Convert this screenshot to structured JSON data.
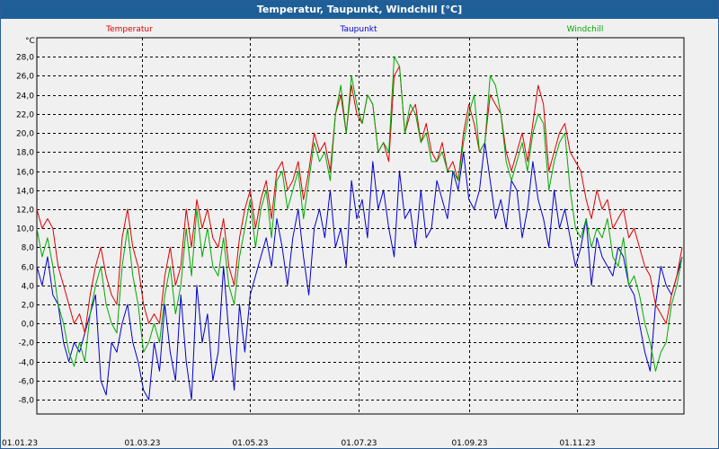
{
  "window": {
    "title": "Temperatur, Taupunkt, Windchill [°C]"
  },
  "chart_data": {
    "type": "line",
    "title": "Temperatur, Taupunkt, Windchill [°C]",
    "ylabel": "°C",
    "xlabel": "",
    "ylim": [
      -9.5,
      30.0
    ],
    "y_ticks": [
      "28,0",
      "26,0",
      "24,0",
      "22,0",
      "20,0",
      "18,0",
      "16,0",
      "14,0",
      "12,0",
      "10,0",
      "8,0",
      "6,0",
      "4,0",
      "2,0",
      "0,0",
      "-2,0",
      "-4,0",
      "-6,0",
      "-8,0"
    ],
    "x_ticks": [
      "01.01.23",
      "01.03.23",
      "01.05.23",
      "01.07.23",
      "01.09.23",
      "01.11.23"
    ],
    "x_tick_days": [
      0,
      59,
      120,
      181,
      243,
      304
    ],
    "x_range_days": [
      0,
      364
    ],
    "grid": true,
    "colors": {
      "Temperatur": "#dd0000",
      "Taupunkt": "#0000cc",
      "Windchill": "#00aa00",
      "background": "#f0f0f0",
      "titlebar": "#1f5f98"
    },
    "legend_position": "top",
    "series": [
      {
        "name": "Temperatur",
        "x_days": [
          0,
          3,
          6,
          9,
          12,
          15,
          18,
          21,
          24,
          27,
          30,
          33,
          36,
          39,
          42,
          45,
          48,
          51,
          54,
          57,
          60,
          63,
          66,
          69,
          72,
          75,
          78,
          81,
          84,
          87,
          90,
          93,
          96,
          99,
          102,
          105,
          108,
          111,
          114,
          117,
          120,
          123,
          126,
          129,
          132,
          135,
          138,
          141,
          144,
          147,
          150,
          153,
          156,
          159,
          162,
          165,
          168,
          171,
          174,
          177,
          180,
          183,
          186,
          189,
          192,
          195,
          198,
          201,
          204,
          207,
          210,
          213,
          216,
          219,
          222,
          225,
          228,
          231,
          234,
          237,
          240,
          243,
          246,
          249,
          252,
          255,
          258,
          261,
          264,
          267,
          270,
          273,
          276,
          279,
          282,
          285,
          288,
          291,
          294,
          297,
          300,
          303,
          306,
          309,
          312,
          315,
          318,
          321,
          324,
          327,
          330,
          333,
          336,
          339,
          342,
          345,
          348,
          351,
          354,
          357,
          360,
          363
        ],
        "values": [
          12.0,
          10.0,
          11.0,
          10.0,
          6.0,
          4.0,
          2.0,
          0.0,
          1.0,
          -1.0,
          3.0,
          6.0,
          8.0,
          5.0,
          3.0,
          2.0,
          9.0,
          12.0,
          8.0,
          6.0,
          2.0,
          0.0,
          1.0,
          0.0,
          5.0,
          8.0,
          4.0,
          6.0,
          12.0,
          8.0,
          13.0,
          10.0,
          12.0,
          9.0,
          8.0,
          11.0,
          6.0,
          4.0,
          9.0,
          12.0,
          14.0,
          10.0,
          13.0,
          15.0,
          11.0,
          16.0,
          17.0,
          14.0,
          15.0,
          17.0,
          13.0,
          16.0,
          20.0,
          18.0,
          19.0,
          16.0,
          22.0,
          24.0,
          20.0,
          25.0,
          22.0,
          21.0,
          24.0,
          23.0,
          18.0,
          19.0,
          17.0,
          26.0,
          27.0,
          20.0,
          22.0,
          23.0,
          19.0,
          21.0,
          18.0,
          17.0,
          19.0,
          16.0,
          17.0,
          15.0,
          20.0,
          23.0,
          21.0,
          18.0,
          19.0,
          24.0,
          23.0,
          22.0,
          18.0,
          16.0,
          18.0,
          20.0,
          17.0,
          21.0,
          25.0,
          23.0,
          16.0,
          18.0,
          20.0,
          21.0,
          18.0,
          17.0,
          16.0,
          13.0,
          11.0,
          14.0,
          12.0,
          13.0,
          10.0,
          11.0,
          12.0,
          9.0,
          10.0,
          8.0,
          6.0,
          5.0,
          2.0,
          1.0,
          0.0,
          3.0,
          5.0,
          8.0,
          9.0,
          7.0,
          10.0,
          11.0
        ]
      },
      {
        "name": "Taupunkt",
        "x_days": [
          0,
          3,
          6,
          9,
          12,
          15,
          18,
          21,
          24,
          27,
          30,
          33,
          36,
          39,
          42,
          45,
          48,
          51,
          54,
          57,
          60,
          63,
          66,
          69,
          72,
          75,
          78,
          81,
          84,
          87,
          90,
          93,
          96,
          99,
          102,
          105,
          108,
          111,
          114,
          117,
          120,
          123,
          126,
          129,
          132,
          135,
          138,
          141,
          144,
          147,
          150,
          153,
          156,
          159,
          162,
          165,
          168,
          171,
          174,
          177,
          180,
          183,
          186,
          189,
          192,
          195,
          198,
          201,
          204,
          207,
          210,
          213,
          216,
          219,
          222,
          225,
          228,
          231,
          234,
          237,
          240,
          243,
          246,
          249,
          252,
          255,
          258,
          261,
          264,
          267,
          270,
          273,
          276,
          279,
          282,
          285,
          288,
          291,
          294,
          297,
          300,
          303,
          306,
          309,
          312,
          315,
          318,
          321,
          324,
          327,
          330,
          333,
          336,
          339,
          342,
          345,
          348,
          351,
          354,
          357,
          360,
          363
        ],
        "values": [
          6.0,
          4.0,
          7.0,
          3.0,
          2.0,
          -2.0,
          -4.0,
          -2.0,
          -3.0,
          -1.0,
          1.0,
          3.0,
          -6.0,
          -7.5,
          -2.0,
          -3.0,
          0.0,
          2.0,
          -2.0,
          -4.0,
          -7.0,
          -8.0,
          -2.0,
          -5.0,
          2.0,
          -3.0,
          -6.0,
          3.0,
          -4.0,
          -8.0,
          4.0,
          -2.0,
          1.0,
          -6.0,
          -3.0,
          6.0,
          -1.0,
          -7.0,
          2.0,
          -3.0,
          3.0,
          5.0,
          7.0,
          9.0,
          6.0,
          11.0,
          8.0,
          4.0,
          9.0,
          12.0,
          7.0,
          3.0,
          10.0,
          12.0,
          9.0,
          14.0,
          8.0,
          10.0,
          6.0,
          15.0,
          11.0,
          13.0,
          9.0,
          17.0,
          12.0,
          14.0,
          10.0,
          7.0,
          16.0,
          11.0,
          12.0,
          8.0,
          14.0,
          9.0,
          10.0,
          15.0,
          13.0,
          11.0,
          16.0,
          14.0,
          18.0,
          13.0,
          12.0,
          14.0,
          19.0,
          15.0,
          11.0,
          13.0,
          10.0,
          15.0,
          14.0,
          9.0,
          12.0,
          17.0,
          13.0,
          11.0,
          8.0,
          14.0,
          10.0,
          12.0,
          9.0,
          6.0,
          8.0,
          11.0,
          4.0,
          9.0,
          7.0,
          6.0,
          5.0,
          8.0,
          7.0,
          4.0,
          3.0,
          0.0,
          -3.0,
          -5.0,
          2.0,
          6.0,
          4.0,
          3.0,
          5.0,
          7.0,
          6.0,
          4.0
        ]
      },
      {
        "name": "Windchill",
        "x_days": [
          0,
          3,
          6,
          9,
          12,
          15,
          18,
          21,
          24,
          27,
          30,
          33,
          36,
          39,
          42,
          45,
          48,
          51,
          54,
          57,
          60,
          63,
          66,
          69,
          72,
          75,
          78,
          81,
          84,
          87,
          90,
          93,
          96,
          99,
          102,
          105,
          108,
          111,
          114,
          117,
          120,
          123,
          126,
          129,
          132,
          135,
          138,
          141,
          144,
          147,
          150,
          153,
          156,
          159,
          162,
          165,
          168,
          171,
          174,
          177,
          180,
          183,
          186,
          189,
          192,
          195,
          198,
          201,
          204,
          207,
          210,
          213,
          216,
          219,
          222,
          225,
          228,
          231,
          234,
          237,
          240,
          243,
          246,
          249,
          252,
          255,
          258,
          261,
          264,
          267,
          270,
          273,
          276,
          279,
          282,
          285,
          288,
          291,
          294,
          297,
          300,
          303,
          306,
          309,
          312,
          315,
          318,
          321,
          324,
          327,
          330,
          333,
          336,
          339,
          342,
          345,
          348,
          351,
          354,
          357,
          360,
          363
        ],
        "values": [
          10.0,
          7.0,
          9.0,
          6.0,
          2.0,
          0.0,
          -3.0,
          -4.5,
          -2.0,
          -4.0,
          1.0,
          4.0,
          6.0,
          2.0,
          0.0,
          -1.0,
          6.0,
          10.0,
          5.0,
          2.0,
          -3.0,
          -2.0,
          0.0,
          -2.0,
          3.0,
          6.0,
          1.0,
          4.0,
          10.0,
          5.0,
          12.0,
          7.0,
          10.0,
          6.0,
          5.0,
          9.0,
          4.0,
          2.0,
          7.0,
          10.0,
          13.0,
          8.0,
          12.0,
          14.0,
          9.0,
          15.0,
          16.0,
          12.0,
          14.0,
          16.0,
          11.0,
          15.0,
          19.0,
          17.0,
          18.0,
          15.0,
          22.0,
          25.0,
          20.0,
          26.0,
          23.0,
          21.0,
          24.0,
          23.0,
          18.0,
          19.0,
          18.0,
          28.0,
          27.0,
          20.0,
          23.0,
          22.0,
          19.0,
          20.0,
          17.0,
          17.0,
          18.0,
          16.0,
          16.0,
          15.0,
          19.0,
          22.0,
          24.0,
          18.0,
          19.0,
          26.0,
          25.0,
          22.0,
          17.0,
          15.0,
          17.0,
          19.0,
          16.0,
          20.0,
          22.0,
          21.0,
          14.0,
          17.0,
          19.0,
          20.0,
          14.0,
          10.0,
          9.0,
          11.0,
          8.0,
          10.0,
          9.0,
          11.0,
          7.0,
          6.0,
          9.0,
          4.0,
          5.0,
          3.0,
          0.0,
          -2.0,
          -5.0,
          -3.0,
          -2.0,
          2.0,
          4.0,
          7.0,
          8.0,
          5.0,
          8.0,
          7.0
        ]
      }
    ]
  }
}
